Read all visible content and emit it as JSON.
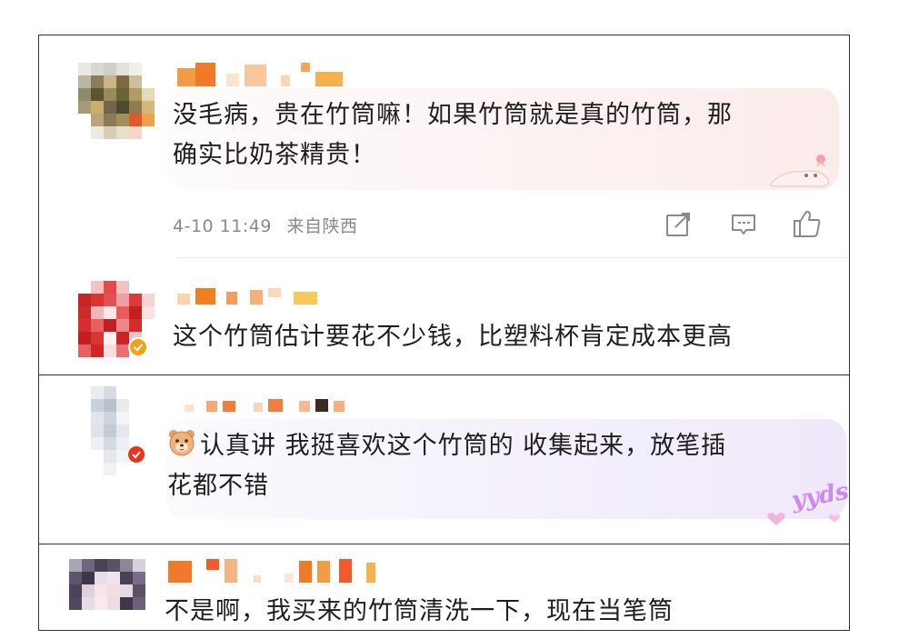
{
  "comments": [
    {
      "text_line1": "没毛病，贵在竹筒嘛！如果竹筒就是真的竹筒，那",
      "text_line2": "确实比奶茶精贵！",
      "time": "4-10 11:49",
      "location": "来自陕西",
      "actions": [
        "share-icon",
        "comment-icon",
        "like-icon"
      ]
    },
    {
      "text_line1": "这个竹筒估计要花不少钱，比塑料杯肯定成本更高",
      "verified_badge_color": "#f0a21a"
    },
    {
      "emoji": "bear-face-emoji",
      "text_line1": "认真讲 我挺喜欢这个竹筒的 收集起来，放笔插",
      "text_line2": "花都不错",
      "sticker_text": "yyds",
      "verified_badge_color": "#e8341c"
    },
    {
      "text_line1": "不是啊，我买来的竹筒清洗一下，现在当笔筒"
    }
  ],
  "colors": {
    "bubble_pink": "#fdeeee",
    "bubble_purple": "#f1ecfb",
    "meta_gray": "#8a8a8a",
    "icon_gray": "#8a8a8a",
    "name_orange": "#f08a2c"
  }
}
